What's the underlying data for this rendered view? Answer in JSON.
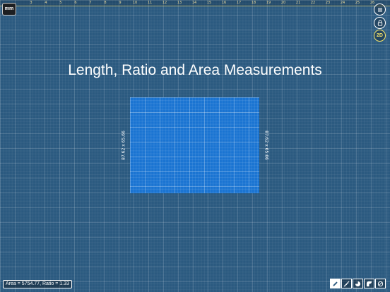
{
  "ruler": {
    "numbers": [
      "3",
      "4",
      "5",
      "6",
      "7",
      "8",
      "9",
      "10",
      "11",
      "12",
      "13",
      "14",
      "15",
      "16",
      "17",
      "18",
      "19",
      "20",
      "21",
      "22",
      "23",
      "24",
      "25",
      "26"
    ]
  },
  "toolbar": {
    "unit_label": "mm",
    "view_mode_label": "2D"
  },
  "main": {
    "title": "Length, Ratio and Area Measurements",
    "measure_left": "87.62 x 65.66",
    "measure_right": "87.62 x 65.66",
    "status": "Area = 5754.77, Ratio = 1.33",
    "shape_color": "#1a74d2"
  },
  "tools": [
    {
      "name": "pencil-tool-icon",
      "active": true
    },
    {
      "name": "measure-tool-icon",
      "active": false
    },
    {
      "name": "pie-tool-icon",
      "active": false
    },
    {
      "name": "shape-tool-icon",
      "active": false
    },
    {
      "name": "protractor-tool-icon",
      "active": false
    }
  ]
}
